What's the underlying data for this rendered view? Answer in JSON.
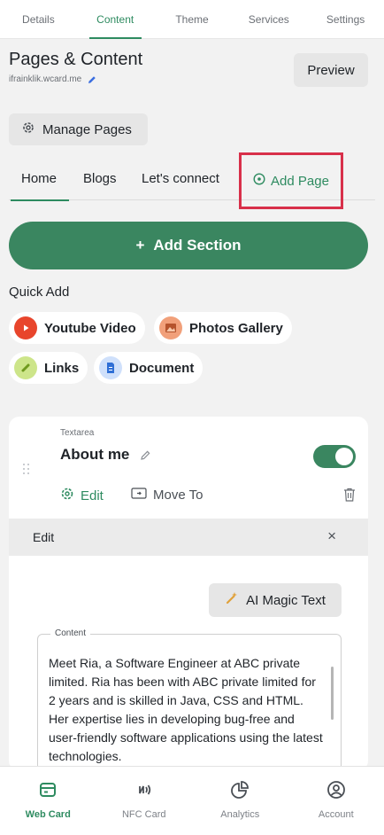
{
  "top_tabs": [
    "Details",
    "Content",
    "Theme",
    "Services",
    "Settings"
  ],
  "header": {
    "title": "Pages & Content",
    "url": "ifrainklik.wcard.me",
    "preview_label": "Preview"
  },
  "manage_pages_label": "Manage Pages",
  "page_tabs": {
    "home": "Home",
    "blogs": "Blogs",
    "connect": "Let's connect",
    "add_page": "Add Page"
  },
  "add_section_label": "Add Section",
  "quick_add": {
    "title": "Quick Add",
    "youtube": "Youtube Video",
    "photos": "Photos Gallery",
    "links": "Links",
    "document": "Document"
  },
  "section_card": {
    "type": "Textarea",
    "title": "About me",
    "enabled": true,
    "edit_label": "Edit",
    "move_label": "Move To"
  },
  "edit_panel": {
    "label": "Edit",
    "close": "×",
    "magic_label": "AI Magic Text",
    "content_label": "Content",
    "content_text": "Meet Ria, a Software Engineer at ABC private limited. Ria has been with ABC private limited for 2 years and is skilled in Java, CSS and HTML. Her expertise lies in developing bug-free and user-friendly software applications using the latest technologies."
  },
  "bottom_nav": [
    "Web Card",
    "NFC Card",
    "Analytics",
    "Account"
  ],
  "colors": {
    "accent": "#2e8b60",
    "button_green": "#3a8660",
    "highlight_border": "#d8304a",
    "youtube_red": "#e8452c",
    "background": "#f2f2f2"
  }
}
